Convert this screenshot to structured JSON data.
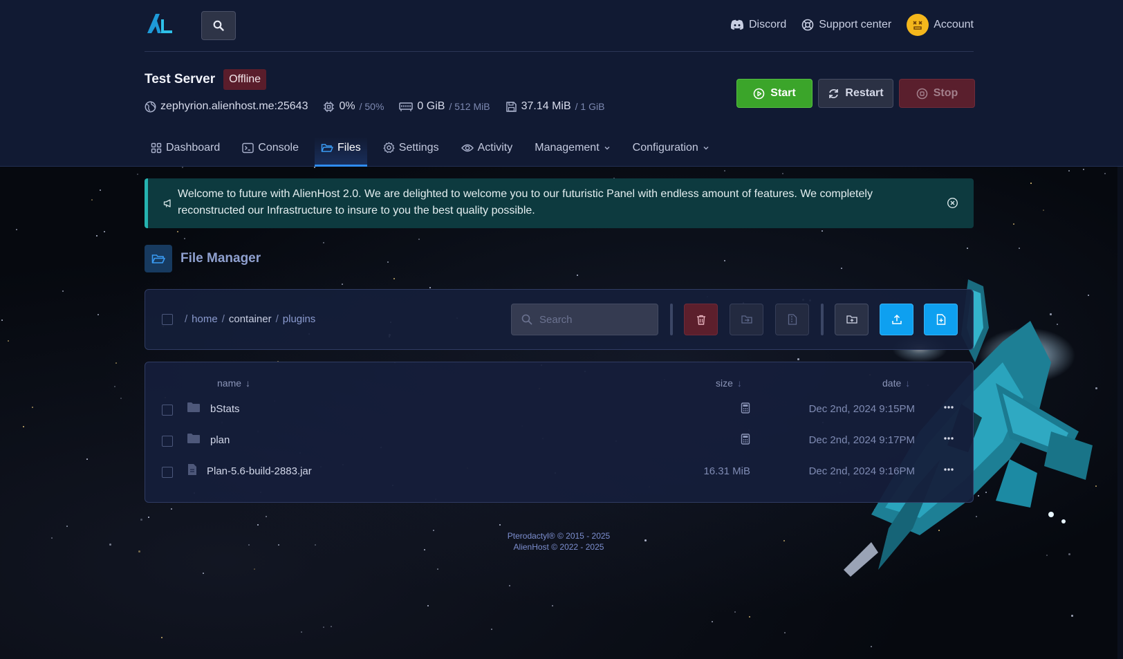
{
  "topbar": {
    "discord_label": "Discord",
    "support_label": "Support center",
    "account_label": "Account"
  },
  "server": {
    "name": "Test Server",
    "status": "Offline",
    "address": "zephyrion.alienhost.me:25643",
    "cpu": "0%",
    "cpu_limit": "/ 50%",
    "memory": "0 GiB",
    "memory_limit": "/ 512 MiB",
    "disk": "37.14 MiB",
    "disk_limit": "/ 1 GiB"
  },
  "power": {
    "start_label": "Start",
    "restart_label": "Restart",
    "stop_label": "Stop"
  },
  "tabs": [
    {
      "label": "Dashboard"
    },
    {
      "label": "Console"
    },
    {
      "label": "Files"
    },
    {
      "label": "Settings"
    },
    {
      "label": "Activity"
    },
    {
      "label": "Management"
    },
    {
      "label": "Configuration"
    }
  ],
  "announcement": {
    "text": "Welcome to future with AlienHost 2.0. We are delighted to welcome you to our futuristic Panel with endless amount of features. We completely reconstructed our Infrastructure to insure to you the best quality possible."
  },
  "file_manager": {
    "title": "File Manager",
    "breadcrumb": {
      "sep": "/",
      "home": "home",
      "container": "container",
      "plugins": "plugins"
    },
    "search_placeholder": "Search",
    "columns": {
      "name": "name",
      "size": "size",
      "date": "date",
      "sort_arrow": "↓"
    },
    "rows": [
      {
        "name": "bStats",
        "type": "folder",
        "size": "",
        "date": "Dec 2nd, 2024 9:15PM"
      },
      {
        "name": "plan",
        "type": "folder",
        "size": "",
        "date": "Dec 2nd, 2024 9:17PM"
      },
      {
        "name": "Plan-5.6-build-2883.jar",
        "type": "file",
        "size": "16.31 MiB",
        "date": "Dec 2nd, 2024 9:16PM"
      }
    ]
  },
  "footer": {
    "line1": "Pterodactyl® © 2015 - 2025",
    "line2": "AlienHost © 2022 - 2025"
  },
  "colors": {
    "header_bg": "#111a33",
    "accent_blue": "#2f8df2",
    "start_green": "#3ba52a",
    "stop_red": "#5a1f2d",
    "upload_blue": "#0ea0f0",
    "announce_teal": "#25b3b0"
  }
}
